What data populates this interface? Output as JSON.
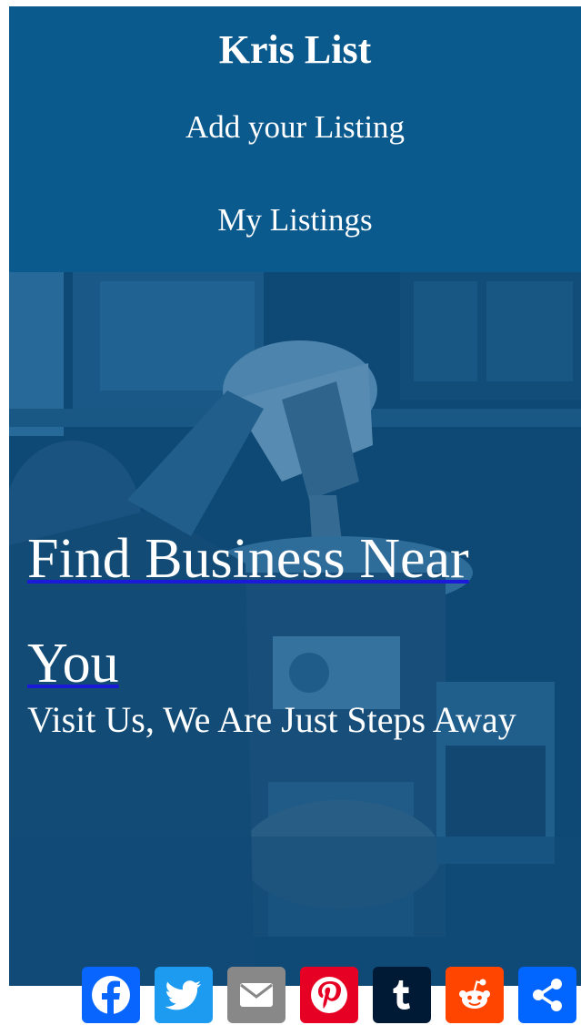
{
  "header": {
    "brand": "Kris List",
    "nav": {
      "add_listing": "Add your Listing",
      "my_listings": "My Listings"
    }
  },
  "hero": {
    "title": "Find Business Near You",
    "subtitle": "Visit Us, We Are Just Steps Away"
  },
  "share": {
    "buttons": [
      {
        "icon": "facebook-icon",
        "color": "#0866ff"
      },
      {
        "icon": "twitter-icon",
        "color": "#1d9bf0"
      },
      {
        "icon": "email-icon",
        "color": "#888888"
      },
      {
        "icon": "pinterest-icon",
        "color": "#e60023"
      },
      {
        "icon": "tumblr-icon",
        "color": "#001935"
      },
      {
        "icon": "reddit-icon",
        "color": "#ff4500"
      },
      {
        "icon": "share-icon",
        "color": "#0166ff"
      }
    ]
  },
  "colors": {
    "header_bg": "#0b5a8e",
    "hero_overlay": "#0a5087",
    "link_underline": "#1a1ad8"
  }
}
